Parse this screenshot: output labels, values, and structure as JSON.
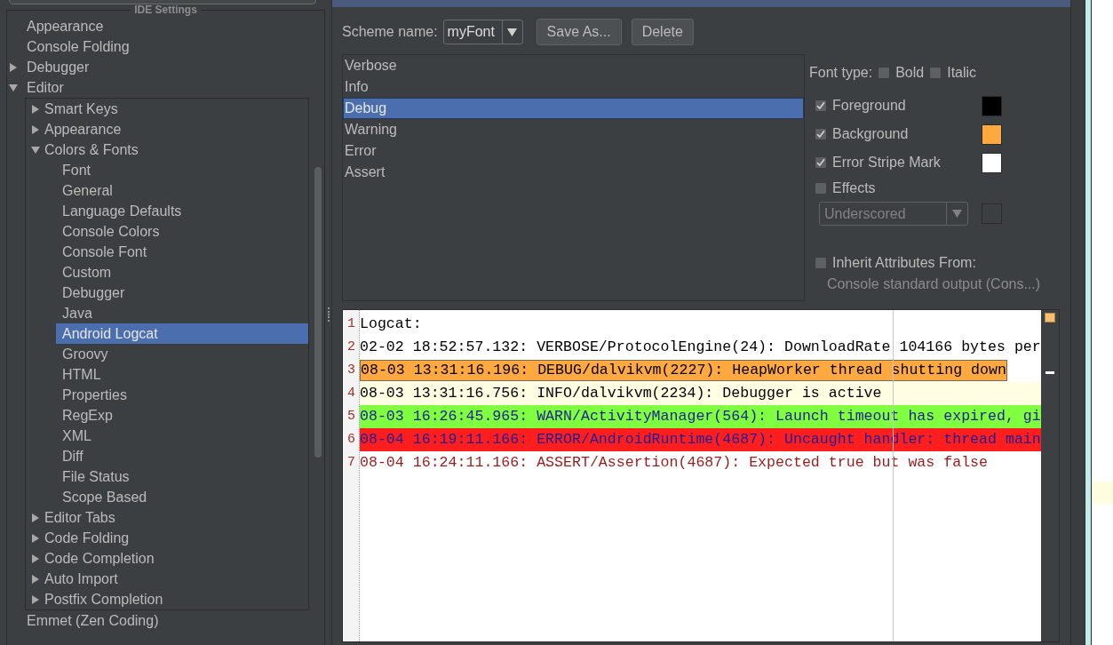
{
  "sidebar": {
    "title": "IDE Settings",
    "tree": [
      {
        "label": "Appearance",
        "selected": false
      },
      {
        "label": "Console Folding",
        "selected": false
      },
      {
        "label": "Debugger",
        "expanded": false,
        "selected": false
      },
      {
        "label": "Editor",
        "expanded": true,
        "selected": false,
        "children": [
          {
            "label": "Smart Keys",
            "expanded": false,
            "selected": false
          },
          {
            "label": "Appearance",
            "expanded": false,
            "selected": false
          },
          {
            "label": "Colors & Fonts",
            "expanded": true,
            "selected": false,
            "children": [
              {
                "label": "Font",
                "selected": false
              },
              {
                "label": "General",
                "selected": false
              },
              {
                "label": "Language Defaults",
                "selected": false
              },
              {
                "label": "Console Colors",
                "selected": false
              },
              {
                "label": "Console Font",
                "selected": false
              },
              {
                "label": "Custom",
                "selected": false
              },
              {
                "label": "Debugger",
                "selected": false
              },
              {
                "label": "Java",
                "selected": false
              },
              {
                "label": "Android Logcat",
                "selected": true
              },
              {
                "label": "Groovy",
                "selected": false
              },
              {
                "label": "HTML",
                "selected": false
              },
              {
                "label": "Properties",
                "selected": false
              },
              {
                "label": "RegExp",
                "selected": false
              },
              {
                "label": "XML",
                "selected": false
              },
              {
                "label": "Diff",
                "selected": false
              },
              {
                "label": "File Status",
                "selected": false
              },
              {
                "label": "Scope Based",
                "selected": false
              }
            ]
          },
          {
            "label": "Editor Tabs",
            "expanded": false,
            "selected": false
          },
          {
            "label": "Code Folding",
            "expanded": false,
            "selected": false
          },
          {
            "label": "Code Completion",
            "expanded": false,
            "selected": false
          },
          {
            "label": "Auto Import",
            "expanded": false,
            "selected": false
          },
          {
            "label": "Postfix Completion",
            "expanded": false,
            "selected": false
          }
        ]
      },
      {
        "label": "Emmet (Zen Coding)",
        "selected": false
      }
    ]
  },
  "scheme": {
    "label": "Scheme name:",
    "value": "myFont",
    "buttons": [
      "Save As...",
      "Delete"
    ]
  },
  "categories": [
    {
      "label": "Verbose",
      "selected": false
    },
    {
      "label": "Info",
      "selected": false
    },
    {
      "label": "Debug",
      "selected": true
    },
    {
      "label": "Warning",
      "selected": false
    },
    {
      "label": "Error",
      "selected": false
    },
    {
      "label": "Assert",
      "selected": false
    }
  ],
  "attributes": {
    "font_type": {
      "label": "Font type:",
      "options": [
        {
          "label": "Bold",
          "checked": false
        },
        {
          "label": "Italic",
          "checked": false
        }
      ]
    },
    "colors": [
      {
        "label": "Foreground",
        "checked": true,
        "color": "#000000"
      },
      {
        "label": "Background",
        "checked": true,
        "color": "#ffa940"
      },
      {
        "label": "Error Stripe Mark",
        "checked": true,
        "color": "#ffffff"
      }
    ],
    "effects": {
      "label": "Effects",
      "checked": false,
      "style": "Underscored",
      "disabled": true
    },
    "inherit": {
      "label": "Inherit Attributes From:",
      "checked": false,
      "source": "Console standard output (Cons...)"
    }
  },
  "preview": {
    "lines": [
      {
        "number": "1",
        "text": "Logcat:",
        "kind": "plain"
      },
      {
        "number": "2",
        "text": "02-02 18:52:57.132: VERBOSE/ProtocolEngine(24): DownloadRate 104166 bytes per",
        "kind": "verbose"
      },
      {
        "number": "3",
        "text": "08-03 13:31:16.196: DEBUG/dalvikvm(2227): HeapWorker thread shutting down",
        "kind": "debug"
      },
      {
        "number": "4",
        "text": "08-03 13:31:16.756: INFO/dalvikvm(2234): Debugger is active",
        "kind": "info"
      },
      {
        "number": "5",
        "text": "08-03 16:26:45.965: WARN/ActivityManager(564): Launch timeout has expired, gi",
        "kind": "warn"
      },
      {
        "number": "6",
        "text": "08-04 16:19:11.166: ERROR/AndroidRuntime(4687): Uncaught handler: thread main",
        "kind": "error"
      },
      {
        "number": "7",
        "text": "08-04 16:24:11.166: ASSERT/Assertion(4687): Expected true but was false",
        "kind": "assert"
      }
    ]
  }
}
